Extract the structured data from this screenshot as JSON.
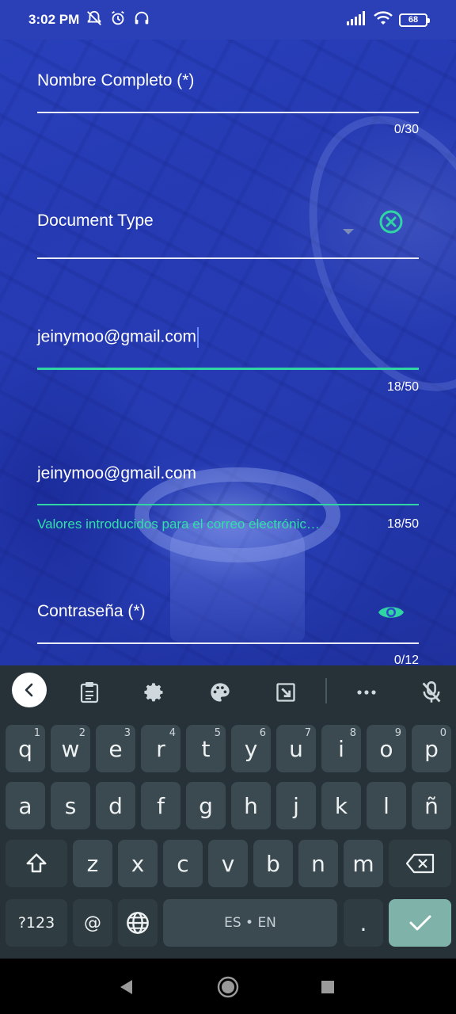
{
  "status_bar": {
    "time": "3:02 PM",
    "battery": "68",
    "left_icons": [
      "silent-notifications-icon",
      "alarm-icon",
      "headset-icon"
    ],
    "right_icons": [
      "signal-icon",
      "wifi-icon",
      "battery-icon"
    ]
  },
  "form": {
    "full_name": {
      "placeholder": "Nombre Completo (*)",
      "counter": "0/30"
    },
    "document_type": {
      "placeholder": "Document Type",
      "clear_icon": "clear-circle-icon"
    },
    "email": {
      "value": "jeinymoo@gmail.com",
      "counter": "18/50"
    },
    "confirm_email": {
      "value": "jeinymoo@gmail.com",
      "helper": "Valores introducidos para el correo electrónic…",
      "counter": "18/50"
    },
    "password": {
      "placeholder": "Contraseña (*)",
      "counter": "0/12",
      "toggle_icon": "eye-icon"
    },
    "colors": {
      "accent": "#2fd6a3",
      "background": "#2f47c9"
    }
  },
  "keyboard": {
    "toolbar": [
      "back-icon",
      "clipboard-icon",
      "settings-icon",
      "palette-icon",
      "resize-icon",
      "more-icon",
      "mic-off-icon"
    ],
    "row1": [
      {
        "k": "q",
        "h": "1"
      },
      {
        "k": "w",
        "h": "2"
      },
      {
        "k": "e",
        "h": "3"
      },
      {
        "k": "r",
        "h": "4"
      },
      {
        "k": "t",
        "h": "5"
      },
      {
        "k": "y",
        "h": "6"
      },
      {
        "k": "u",
        "h": "7"
      },
      {
        "k": "i",
        "h": "8"
      },
      {
        "k": "o",
        "h": "9"
      },
      {
        "k": "p",
        "h": "0"
      }
    ],
    "row2": [
      "a",
      "s",
      "d",
      "f",
      "g",
      "h",
      "j",
      "k",
      "l",
      "ñ"
    ],
    "row3": [
      "z",
      "x",
      "c",
      "v",
      "b",
      "n",
      "m"
    ],
    "row4": {
      "symbols": "?123",
      "at": "@",
      "space": "ES • EN",
      "period": "."
    },
    "colors": {
      "background": "#263238",
      "key": "#3b4a51",
      "enter": "#7fb3aa"
    }
  },
  "nav_bar": {
    "icons": [
      "back-triangle-icon",
      "home-circle-icon",
      "recents-square-icon"
    ]
  }
}
